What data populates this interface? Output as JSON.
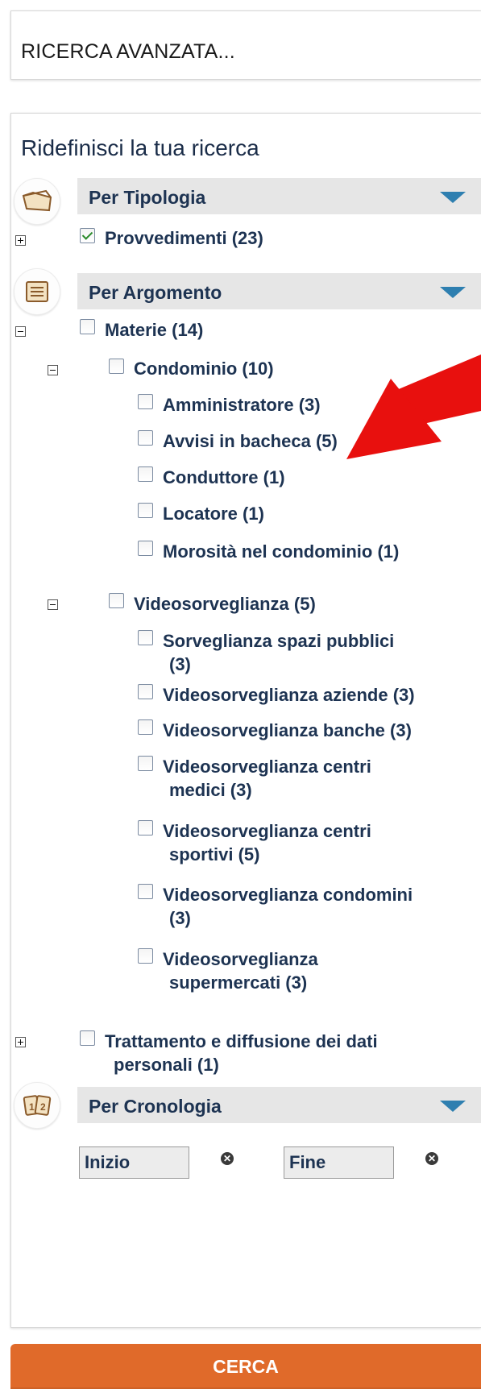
{
  "advanced_search": {
    "title": "RICERCA AVANZATA..."
  },
  "refine": {
    "title": "Ridefinisci la tua ricerca"
  },
  "sections": {
    "tipologia": {
      "label": "Per Tipologia",
      "icon": "folder-icon"
    },
    "argomento": {
      "label": "Per Argomento",
      "icon": "document-list-icon"
    },
    "cronologia": {
      "label": "Per Cronologia",
      "icon": "calendar-icon"
    }
  },
  "tipologia_items": [
    {
      "label": "Provvedimenti (23)",
      "checked": true
    }
  ],
  "argomento_tree": {
    "materie": "Materie (14)",
    "condominio": "Condominio (10)",
    "condominio_children": [
      "Amministratore (3)",
      "Avvisi in bacheca (5)",
      "Conduttore (1)",
      "Locatore (1)",
      "Morosità nel condominio (1)"
    ],
    "videosorveglianza": "Videosorveglianza (5)",
    "video_children": [
      {
        "line1": "Sorveglianza spazi pubblici",
        "line2": "(3)"
      },
      {
        "line1": "Videosorveglianza aziende (3)",
        "line2": ""
      },
      {
        "line1": "Videosorveglianza banche (3)",
        "line2": ""
      },
      {
        "line1": "Videosorveglianza centri",
        "line2": "medici (3)"
      },
      {
        "line1": "Videosorveglianza centri",
        "line2": "sportivi (5)"
      },
      {
        "line1": "Videosorveglianza condomini",
        "line2": "(3)"
      },
      {
        "line1": "Videosorveglianza",
        "line2": "supermercati (3)"
      }
    ],
    "trattamento": {
      "line1": "Trattamento e diffusione dei dati",
      "line2": "personali (1)"
    }
  },
  "cronologia": {
    "start_placeholder": "Inizio",
    "end_placeholder": "Fine"
  },
  "search_button": "CERCA",
  "colors": {
    "accent": "#e06a2a",
    "arrow_annotation": "#e8100e",
    "section_arrow": "#2e7fb0",
    "text": "#1d3352"
  }
}
